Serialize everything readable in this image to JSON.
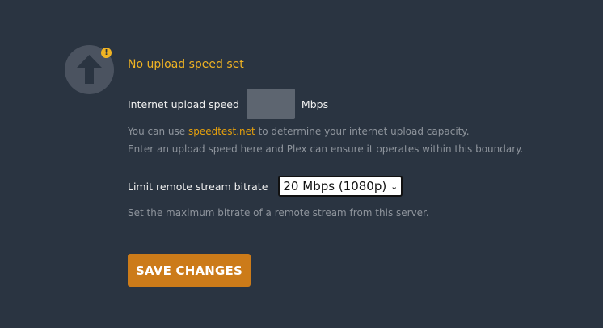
{
  "section": {
    "heading": "No upload speed set",
    "warning_glyph": "!"
  },
  "upload_speed": {
    "label": "Internet upload speed",
    "value": "",
    "unit": "Mbps"
  },
  "help": {
    "line1_prefix": "You can use ",
    "line1_link": "speedtest.net",
    "line1_suffix": " to determine your internet upload capacity.",
    "line2": "Enter an upload speed here and Plex can ensure it operates within this boundary.",
    "bitrate_help": "Set the maximum bitrate of a remote stream from this server."
  },
  "bitrate": {
    "label": "Limit remote stream bitrate",
    "selected": "20 Mbps (1080p)"
  },
  "actions": {
    "save_label": "SAVE CHANGES"
  },
  "icons": {
    "upload": "upload-arrow-icon",
    "warning": "warning-icon",
    "chevron": "chevron-down-icon"
  },
  "colors": {
    "background": "#2a3441",
    "accent": "#cc7b19",
    "warning": "#f0b323",
    "link": "#e5a00d",
    "muted_text": "#8e949c"
  }
}
